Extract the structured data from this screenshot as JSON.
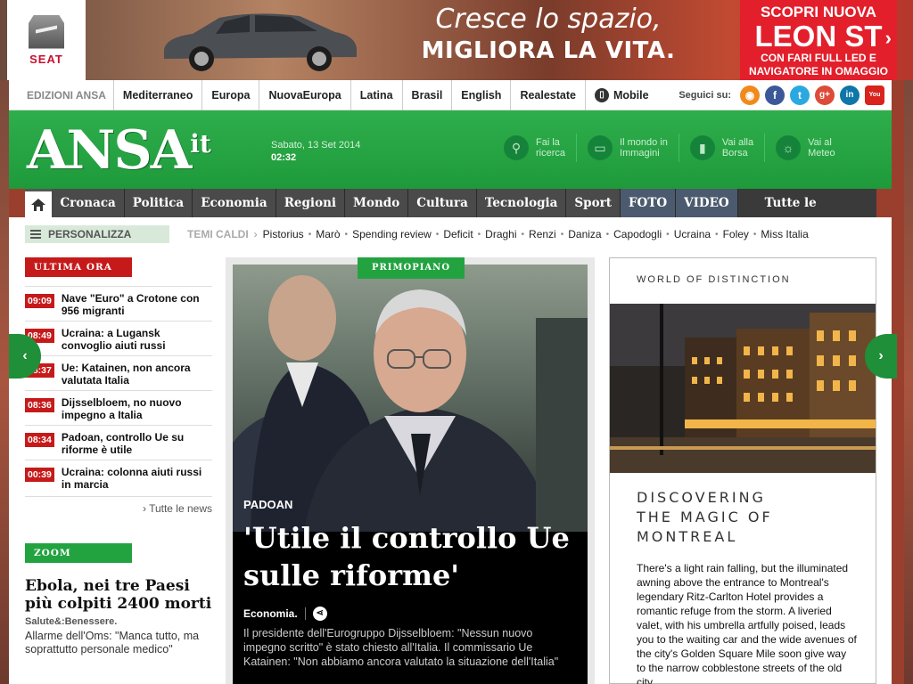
{
  "ad": {
    "brand": "SEAT",
    "headline_line1": "Cresce lo spazio,",
    "headline_line2": "MIGLIORA LA VITA.",
    "promo_line1": "SCOPRI NUOVA",
    "promo_line2": "LEON ST",
    "promo_line3": "CON FARI FULL LED E",
    "promo_line4": "NAVIGATORE IN OMAGGIO",
    "colors": {
      "promo_bg": "#e31f2b",
      "brand_red": "#c8102e"
    }
  },
  "editions": {
    "label": "EDIZIONI ANSA",
    "items": [
      "Mediterraneo",
      "Europa",
      "NuovaEuropa",
      "Latina",
      "Brasil",
      "English",
      "Realestate",
      "Mobile"
    ],
    "follow_label": "Seguici su:",
    "social": [
      {
        "icon": "rss-icon",
        "glyph": "◉",
        "color": "#f08a1c"
      },
      {
        "icon": "facebook-icon",
        "glyph": "f",
        "color": "#3b5998"
      },
      {
        "icon": "twitter-icon",
        "glyph": "t",
        "color": "#2aa9e0"
      },
      {
        "icon": "googleplus-icon",
        "glyph": "g+",
        "color": "#dd4b39"
      },
      {
        "icon": "linkedin-icon",
        "glyph": "in",
        "color": "#0e76a8"
      },
      {
        "icon": "youtube-icon",
        "glyph": "You",
        "color": "#d8241c"
      }
    ]
  },
  "header": {
    "logo": "ANSA",
    "logo_suffix": "it",
    "date": "Sabato, 13 Set 2014",
    "time": "02:32",
    "buttons": [
      {
        "label1": "Fai la",
        "label2": "ricerca",
        "icon": "search-icon",
        "glyph": "⚲"
      },
      {
        "label1": "Il mondo in",
        "label2": "Immagini",
        "icon": "monitor-icon",
        "glyph": "▭"
      },
      {
        "label1": "Vai alla",
        "label2": "Borsa",
        "icon": "chart-icon",
        "glyph": "▮"
      },
      {
        "label1": "Vai al",
        "label2": "Meteo",
        "icon": "weather-icon",
        "glyph": "☼"
      }
    ],
    "colors": {
      "green": "#1e9a3b"
    }
  },
  "nav": {
    "home_icon": "home-icon",
    "sections": [
      "Cronaca",
      "Politica",
      "Economia",
      "Regioni +",
      "Mondo",
      "Cultura",
      "Tecnologia",
      "Sport",
      "FOTO",
      "VIDEO"
    ],
    "all_sections": "Tutte le sezioni +"
  },
  "hot": {
    "personalizza": "PERSONALIZZA",
    "label": "TEMI CALDI",
    "topics": [
      "Pistorius",
      "Marò",
      "Spending review",
      "Deficit",
      "Draghi",
      "Renzi",
      "Daniza",
      "Capodogli",
      "Ucraina",
      "Foley",
      "Miss Italia"
    ]
  },
  "ultima_ora": {
    "label": "ULTIMA ORA",
    "items": [
      {
        "time": "09:09",
        "title": "Nave \"Euro\" a Crotone con 956 migranti"
      },
      {
        "time": "08:49",
        "title": "Ucraina: a Lugansk convoglio aiuti russi"
      },
      {
        "time": "08:37",
        "title": "Ue: Katainen, non ancora valutata Italia"
      },
      {
        "time": "08:36",
        "title": "Dijsselbloem, no nuovo impegno a Italia"
      },
      {
        "time": "08:34",
        "title": "Padoan, controllo Ue su riforme è utile"
      },
      {
        "time": "00:39",
        "title": "Ucraina: colonna aiuti russi in marcia"
      }
    ],
    "all_news": "› Tutte le news"
  },
  "zoom": {
    "label": "ZOOM",
    "headline": "Ebola, nei tre Paesi più colpiti 2400 morti",
    "category": "Salute&:Benessere.",
    "summary": "Allarme dell'Oms: \"Manca tutto, ma soprattutto personale medico\""
  },
  "lead": {
    "badge": "PRIMOPIANO",
    "kicker": "PADOAN",
    "headline": "'Utile il controllo Ue sulle riforme'",
    "section": "Economia.",
    "text": "Il presidente dell'Eurogruppo Dijsselbloem: \"Nessun nuovo impegno scritto\" è stato chiesto all'Italia. Il commissario Ue Katainen: \"Non abbiamo ancora valutato la situazione dell'Italia\""
  },
  "side_ad": {
    "tag": "WORLD OF DISTINCTION",
    "heading_line1": "DISCOVERING",
    "heading_line2": "THE MAGIC OF",
    "heading_line3": "MONTREAL",
    "body": "There's a light rain falling, but the illuminated awning above the entrance to Montreal's legendary Ritz-Carlton Hotel provides a romantic refuge from the storm. A liveried valet, with his umbrella artfully poised, leads you to the waiting car and the wide avenues of the city's Golden Square Mile soon give way to the narrow cobblestone streets of the old city."
  }
}
